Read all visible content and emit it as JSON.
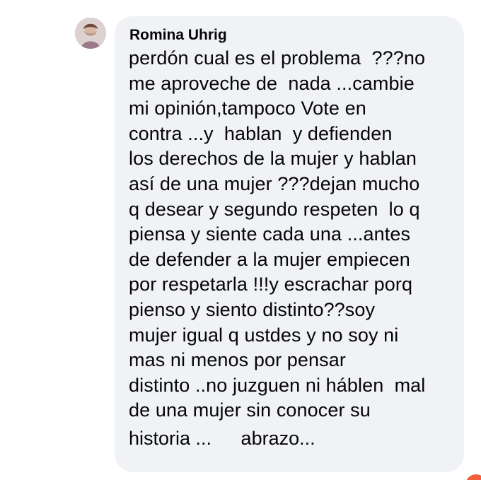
{
  "comment": {
    "author": "Romina Uhrig",
    "text": "perdón cual es el problema  ???no\nme aproveche de  nada ...cambie\nmi opinión,tampoco Vote en\ncontra ...y  hablan  y defienden\nlos derechos de la mujer y hablan\nasí de una mujer ???dejan mucho\nq desear y segundo respeten  lo q\npiensa y siente cada una ...antes\nde defender a la mujer empiecen\npor respetarla !!!y escrachar porq\npienso y siento distinto??soy\nmujer igual q ustdes y no soy ni\nmas ni menos por pensar\ndistinto ..no juzguen ni háblen  mal\nde una mujer sin conocer su",
    "last_line_before_emoji": "historia ... ",
    "emoji": "face-screaming-in-fear-icon",
    "last_line_after_emoji": "abrazo..."
  },
  "colors": {
    "bubble_bg": "#f0f2f5",
    "text": "#050505",
    "reaction_accent": "#f25f3a"
  }
}
